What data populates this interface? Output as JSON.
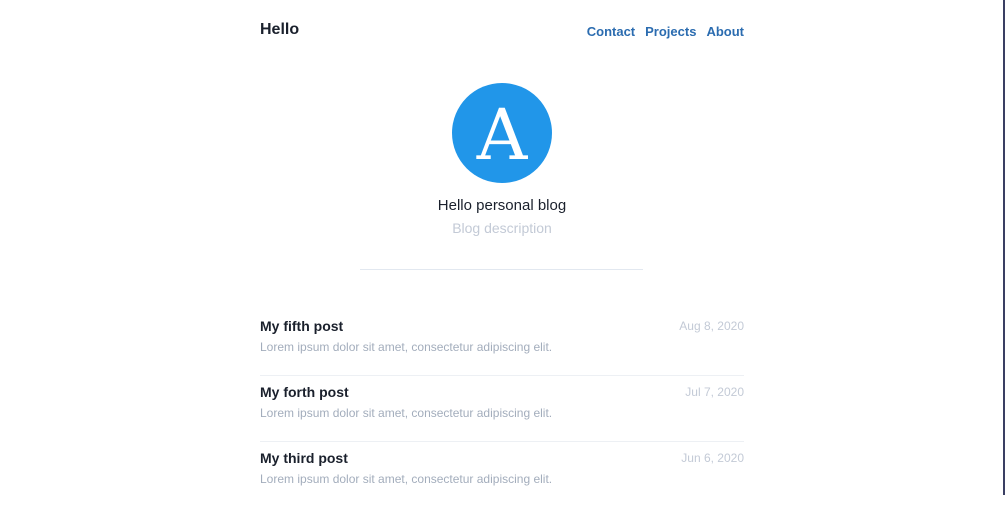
{
  "header": {
    "brand": "Hello",
    "nav": [
      "Contact",
      "Projects",
      "About"
    ]
  },
  "hero": {
    "avatar_letter": "A",
    "avatar_color": "#2196e9",
    "title": "Hello personal blog",
    "description": "Blog description"
  },
  "posts": [
    {
      "title": "My fifth post",
      "excerpt": "Lorem ipsum dolor sit amet, consectetur adipiscing elit.",
      "date": "Aug 8, 2020"
    },
    {
      "title": "My forth post",
      "excerpt": "Lorem ipsum dolor sit amet, consectetur adipiscing elit.",
      "date": "Jul 7, 2020"
    },
    {
      "title": "My third post",
      "excerpt": "Lorem ipsum dolor sit amet, consectetur adipiscing elit.",
      "date": "Jun 6, 2020"
    }
  ],
  "colors": {
    "link": "#2b6cb0",
    "text": "#1a202c",
    "muted": "#c3cad6"
  }
}
